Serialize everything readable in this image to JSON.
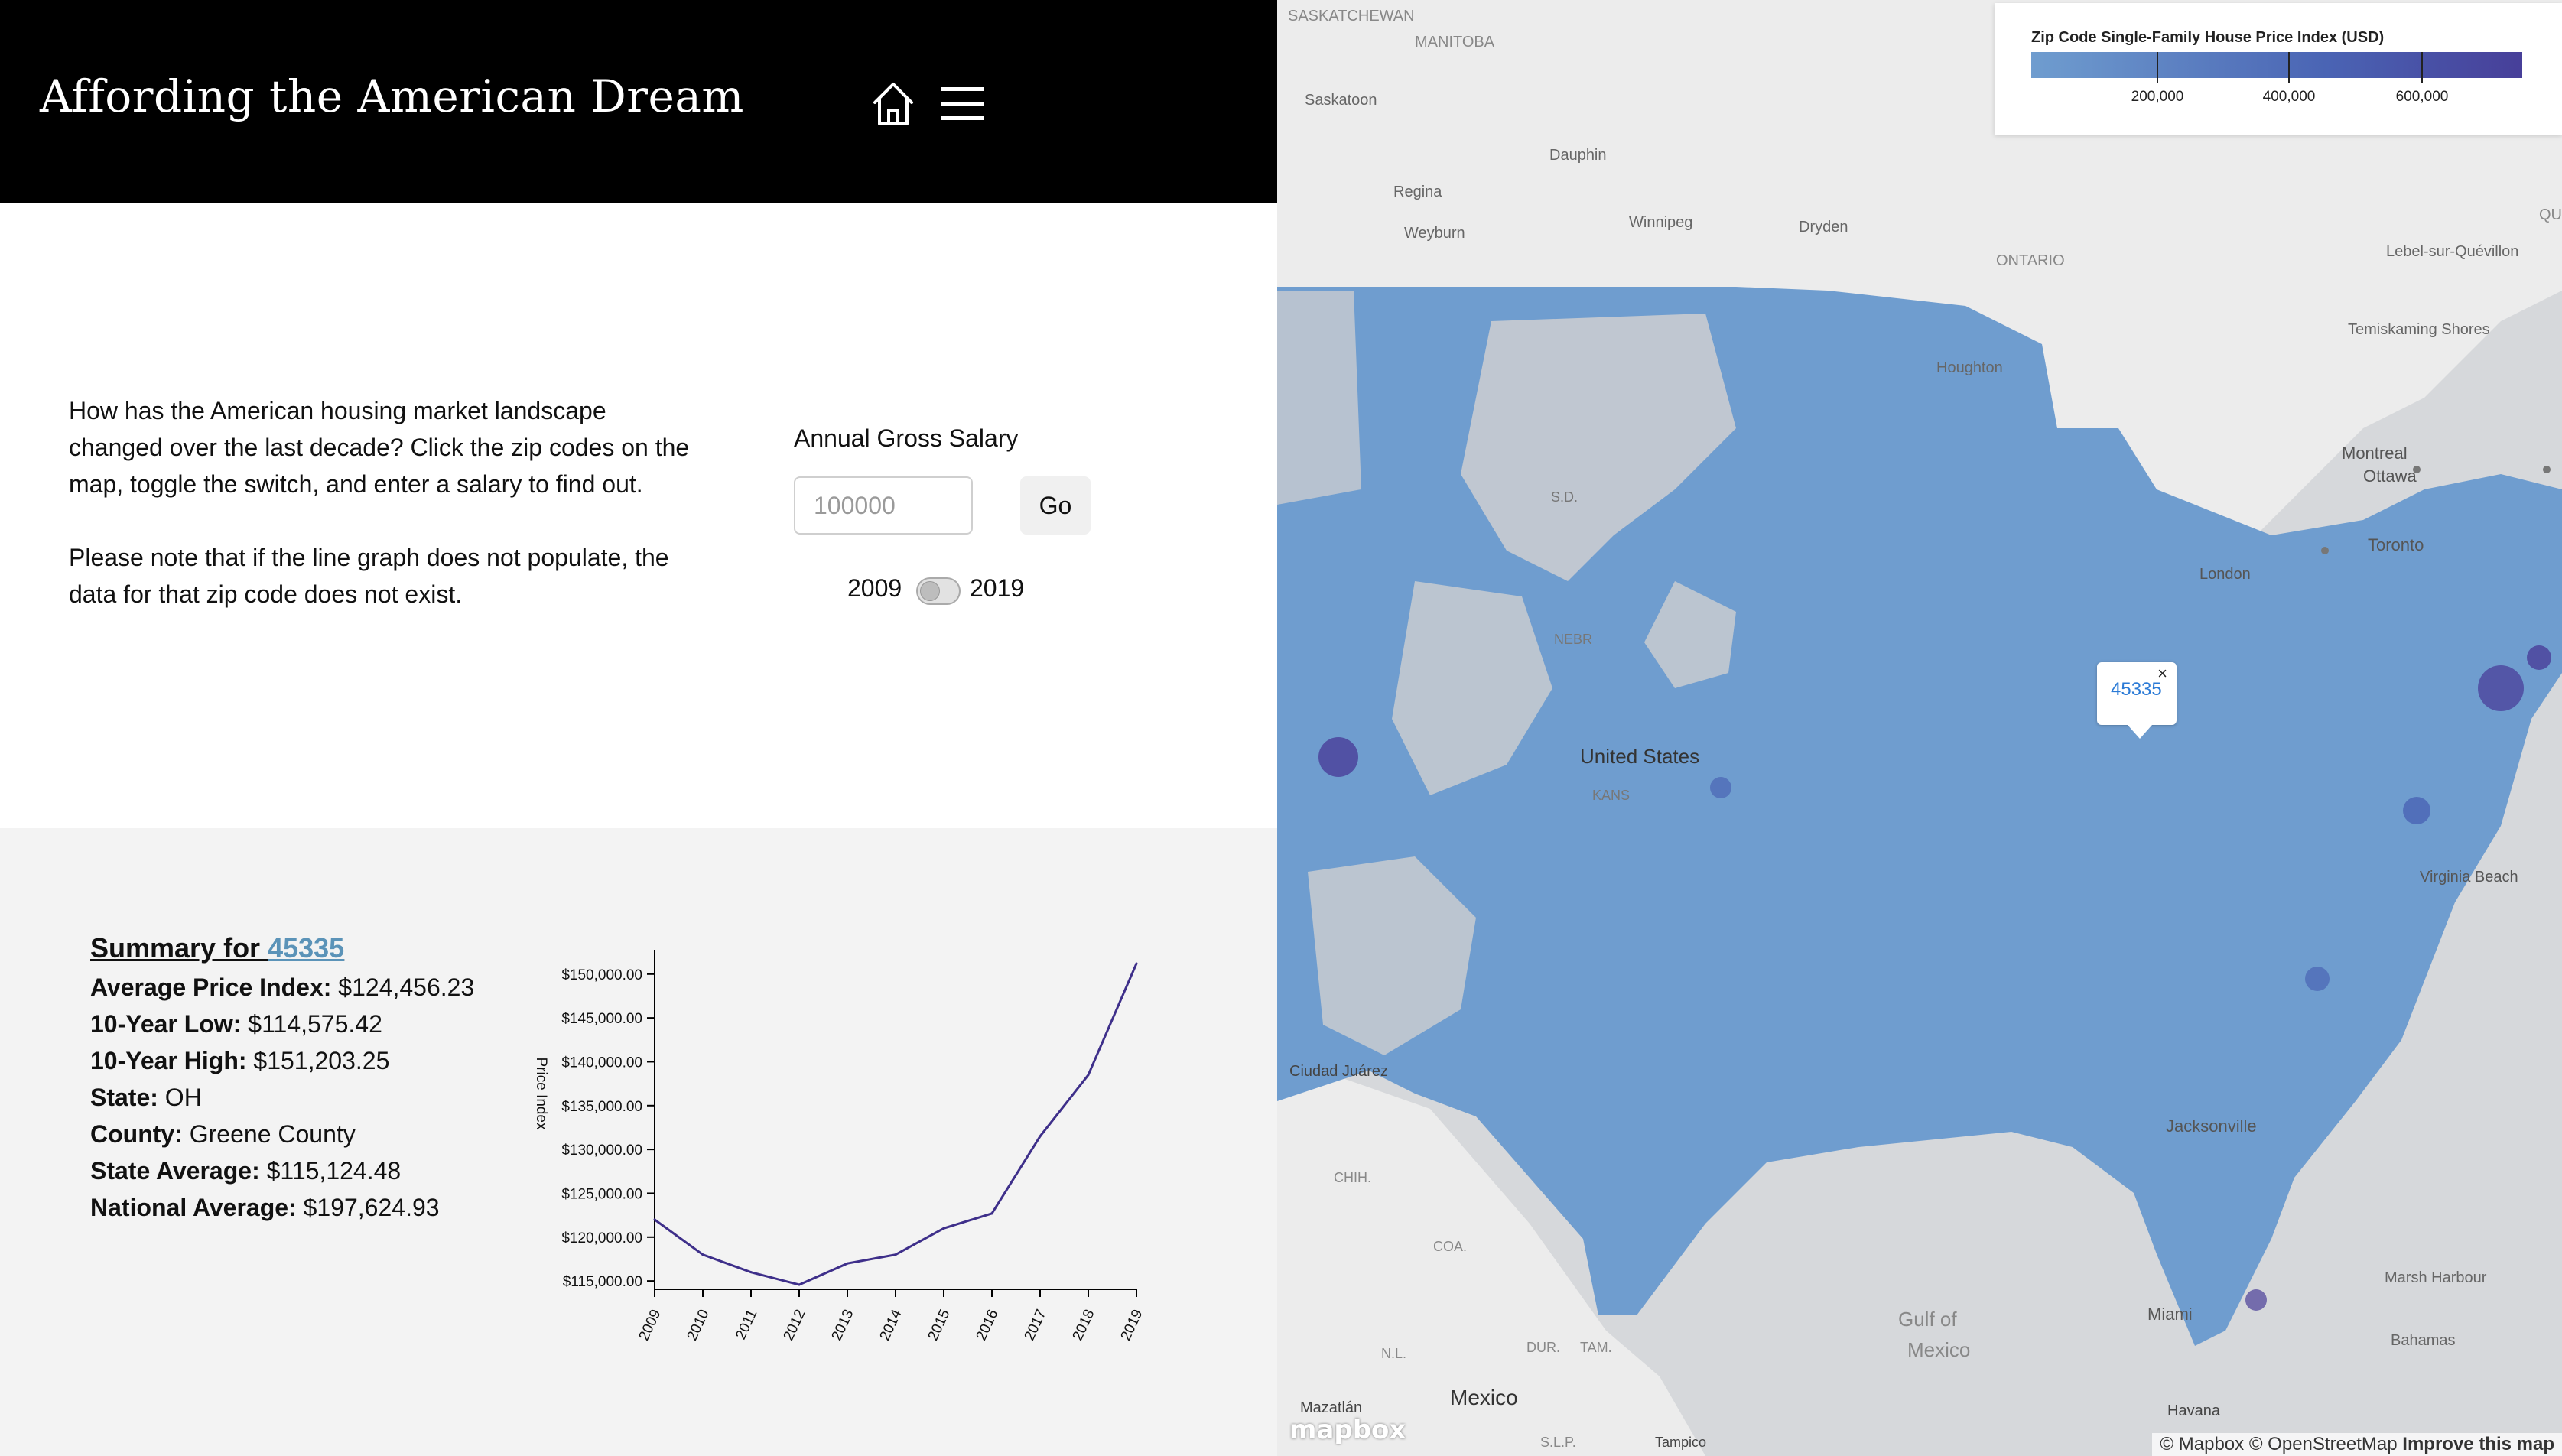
{
  "header": {
    "title": "Affording the American Dream",
    "home_icon": "home-icon",
    "menu_icon": "hamburger-menu-icon"
  },
  "intro": {
    "paragraph1": "How has the American housing market landscape changed over the last decade? Click the zip codes on the map, toggle the switch, and enter a salary to find out.",
    "paragraph2": "Please note that if the line graph does not populate, the data for that zip code does not exist."
  },
  "salary": {
    "label": "Annual Gross Salary",
    "placeholder": "100000",
    "value": "",
    "go_label": "Go"
  },
  "year_toggle": {
    "left_label": "2009",
    "right_label": "2019",
    "selected": "2009"
  },
  "summary": {
    "title_prefix": "Summary for ",
    "zip": "45335",
    "rows": [
      {
        "label": "Average Price Index:",
        "value": "$124,456.23"
      },
      {
        "label": "10-Year Low:",
        "value": "$114,575.42"
      },
      {
        "label": "10-Year High:",
        "value": "$151,203.25"
      },
      {
        "label": "State:",
        "value": "OH"
      },
      {
        "label": "County:",
        "value": "Greene County"
      },
      {
        "label": "State Average:",
        "value": "$115,124.48"
      },
      {
        "label": "National Average:",
        "value": "$197,624.93"
      }
    ]
  },
  "chart_data": {
    "type": "line",
    "ylabel": "Price Index",
    "xlabel": "",
    "x": [
      "2009",
      "2010",
      "2011",
      "2012",
      "2013",
      "2014",
      "2015",
      "2016",
      "2017",
      "2018",
      "2019"
    ],
    "series": [
      {
        "values": [
          122000,
          118000,
          116000,
          114575,
          117000,
          118000,
          121000,
          122700,
          131500,
          138500,
          151203
        ]
      }
    ],
    "ylim": [
      114575,
      151203
    ],
    "yticks": [
      115000,
      120000,
      125000,
      130000,
      135000,
      140000,
      145000,
      150000
    ],
    "ytick_labels": [
      "$115,000.00",
      "$120,000.00",
      "$125,000.00",
      "$130,000.00",
      "$135,000.00",
      "$140,000.00",
      "$145,000.00",
      "$150,000.00"
    ],
    "line_color": "#3e2f8a"
  },
  "map": {
    "legend": {
      "title": "Zip Code Single-Family House Price Index (USD)",
      "ticks": [
        "200,000",
        "400,000",
        "600,000"
      ],
      "colors": [
        "#6f9dcf",
        "#4a64b4",
        "#473f99"
      ]
    },
    "popup": {
      "zip": "45335",
      "close": "×"
    },
    "places": [
      "SASKATCHEWAN",
      "MANITOBA",
      "Saskatoon",
      "Dauphin",
      "Regina",
      "Weyburn",
      "Winnipeg",
      "Dryden",
      "ONTARIO",
      "QUÉB",
      "Lebel-sur-Quévillon",
      "Temiskaming Shores",
      "Houghton",
      "Montreal",
      "Ottawa",
      "Toronto",
      "London",
      "S.D.",
      "NEBR",
      "KANS",
      "United States",
      "Virginia Beach",
      "Jacksonville",
      "Miami",
      "Marsh Harbour",
      "Bahamas",
      "Gulf of",
      "Mexico",
      "Mexico",
      "CHIH.",
      "COA.",
      "N.L.",
      "DUR.",
      "TAM.",
      "Mazatlán",
      "Tampico",
      "S.L.P.",
      "Havana",
      "Ciudad Juárez"
    ],
    "attribution": {
      "mapbox": "© Mapbox",
      "osm": "© OpenStreetMap",
      "improve": "Improve this map"
    },
    "logo": "mapbox"
  }
}
